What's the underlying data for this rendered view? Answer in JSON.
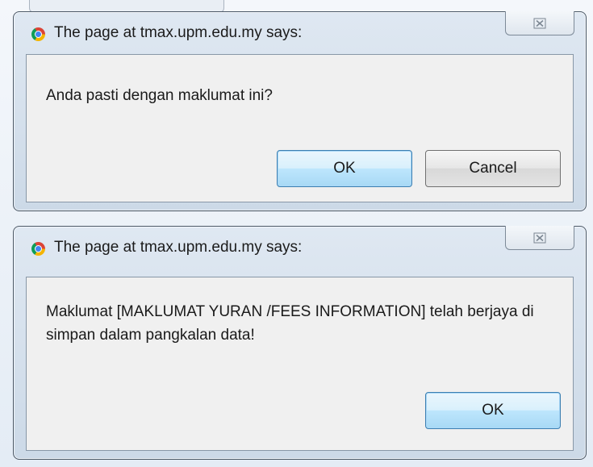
{
  "dialogs": [
    {
      "title": "The page at tmax.upm.edu.my says:",
      "close_icon": "close-icon",
      "message": "Anda pasti dengan maklumat ini?",
      "buttons": {
        "ok_label": "OK",
        "cancel_label": "Cancel"
      }
    },
    {
      "title": "The page at tmax.upm.edu.my says:",
      "close_icon": "close-icon",
      "message": "Maklumat [MAKLUMAT YURAN /FEES INFORMATION] telah berjaya di simpan dalam pangkalan data!",
      "buttons": {
        "ok_label": "OK"
      }
    }
  ],
  "icons": {
    "close_glyph": "⛝",
    "browser_icon": "chrome-icon"
  },
  "colors": {
    "default_button_border": "#3c7fb1",
    "panel_background": "#f0f0f0",
    "frame_background": "#ccd9e7"
  }
}
